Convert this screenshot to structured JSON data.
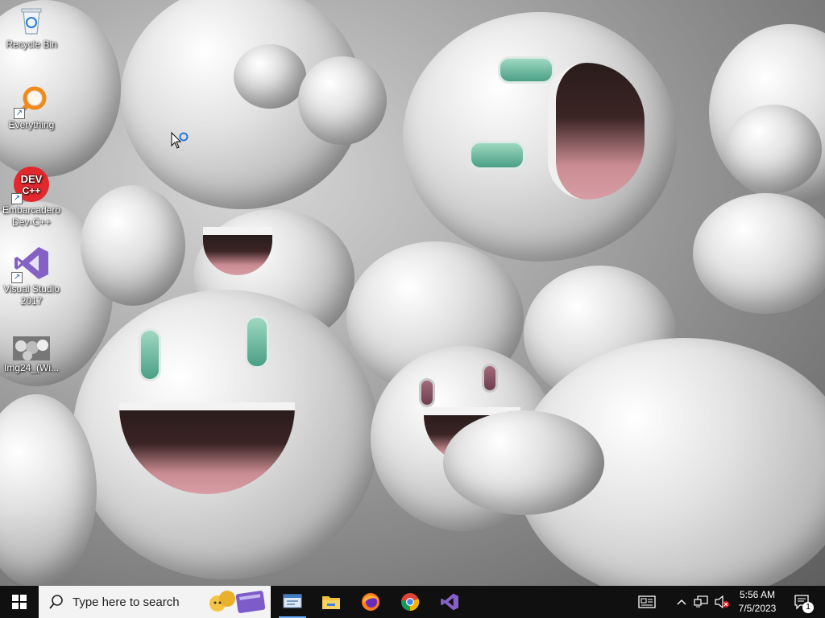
{
  "desktop": {
    "icons": [
      {
        "label": "Recycle Bin",
        "icon": "recycle-bin-icon"
      },
      {
        "label": "Everything",
        "icon": "everything-search-icon"
      },
      {
        "label": "Embarcadero Dev-C++",
        "icon": "devcpp-icon"
      },
      {
        "label": "Visual Studio 2017",
        "icon": "visual-studio-icon"
      },
      {
        "label": "Img24_(Wi...",
        "icon": "image-file-icon"
      }
    ]
  },
  "taskbar": {
    "search_placeholder": "Type here to search",
    "pinned": [
      {
        "name": "task-view",
        "icon": "task-view-icon"
      },
      {
        "name": "file-explorer",
        "icon": "folder-icon"
      },
      {
        "name": "firefox",
        "icon": "firefox-icon"
      },
      {
        "name": "chrome",
        "icon": "chrome-icon"
      },
      {
        "name": "visual-studio",
        "icon": "visual-studio-icon"
      }
    ],
    "clock": {
      "time": "5:56 AM",
      "date": "7/5/2023"
    },
    "notification_count": "1"
  },
  "colors": {
    "taskbar_bg": "#101010",
    "accent": "#6fb0ff",
    "vs_purple": "#8661c5",
    "devcpp_red": "#e0282d",
    "everything_orange": "#f08a1c"
  }
}
